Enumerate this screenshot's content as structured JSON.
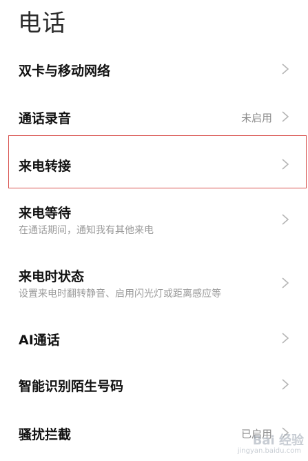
{
  "header": {
    "title": "电话"
  },
  "settings": {
    "items": [
      {
        "label": "双卡与移动网络",
        "subtitle": "",
        "value": ""
      },
      {
        "label": "通话录音",
        "subtitle": "",
        "value": "未启用"
      },
      {
        "label": "来电转接",
        "subtitle": "",
        "value": ""
      },
      {
        "label": "来电等待",
        "subtitle": "在通话期间，通知我有其他来电",
        "value": ""
      },
      {
        "label": "来电时状态",
        "subtitle": "设置来电时翻转静音、启用闪光灯或距离感应等",
        "value": ""
      },
      {
        "label": "AI通话",
        "subtitle": "",
        "value": ""
      },
      {
        "label": "智能识别陌生号码",
        "subtitle": "",
        "value": ""
      },
      {
        "label": "骚扰拦截",
        "subtitle": "",
        "value": "已启用"
      }
    ]
  },
  "watermark": {
    "main": "Bai 经验",
    "sub": "jingyan.baidu.com"
  },
  "colors": {
    "highlight_border": "#d9534f",
    "chevron": "#b5b5b5"
  },
  "icons": {
    "chevron": "chevron-right-icon",
    "highlight": "red-rectangle-annotation"
  }
}
